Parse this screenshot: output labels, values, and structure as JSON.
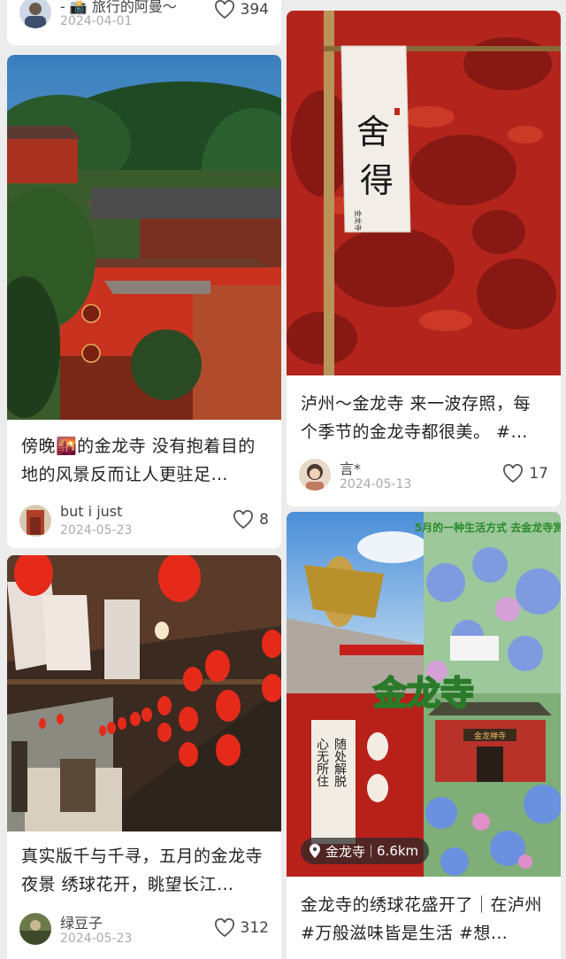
{
  "colors": {
    "accent_red": "#c8261e",
    "text": "#222222",
    "muted": "#aaaaaa"
  },
  "left_column": [
    {
      "author": "- 📸 旅行的阿曼～",
      "date": "2024-04-01",
      "likes": "394",
      "image_desc": "top-cut"
    },
    {
      "title": "傍晚🌇的金龙寺 没有抱着目的地的风景反而让人更驻足…",
      "author": "but i just",
      "date": "2024-05-23",
      "likes": "8"
    },
    {
      "title": "真实版千与千寻，五月的金龙寺夜景 绣球花开，眺望长江…",
      "author": "绿豆子",
      "date": "2024-05-23",
      "likes": "312"
    }
  ],
  "right_column": [
    {
      "title": "泸州～金龙寺 来一波存照，每个季节的金龙寺都很美。 #…",
      "author": "言*",
      "date": "2024-05-13",
      "likes": "17",
      "banner_text": "舍得",
      "banner_small": "金龙寺"
    },
    {
      "title": "金龙寺的绣球花盛开了｜在泸州 #万般滋味皆是生活 #想…",
      "overlay_title": "金龙寺",
      "overlay_top": "5月的一种生活方式 去金龙寺赏花",
      "sign_text": "心无所住 随处解脱",
      "gate_text": "金龙禅寺",
      "location": "金龙寺",
      "distance": "6.6km"
    }
  ]
}
